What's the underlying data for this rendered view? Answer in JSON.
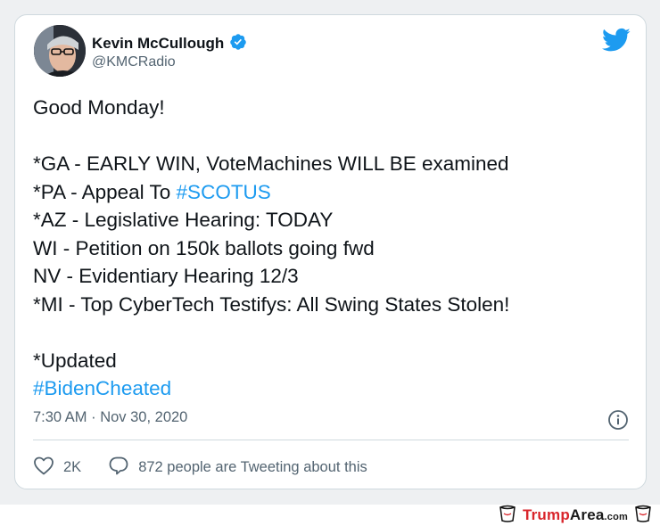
{
  "tweet": {
    "author": {
      "name": "Kevin McCullough",
      "handle": "@KMCRadio",
      "verified": true
    },
    "lines": [
      {
        "text": "Good Monday!"
      },
      {
        "text": ""
      },
      {
        "text": "*GA - EARLY WIN, VoteMachines WILL BE examined"
      },
      {
        "prefix": "*PA - Appeal To ",
        "hashtag": "#SCOTUS"
      },
      {
        "text": "*AZ - Legislative Hearing: TODAY"
      },
      {
        "text": "WI - Petition on 150k ballots going fwd"
      },
      {
        "text": "NV - Evidentiary Hearing 12/3"
      },
      {
        "text": "*MI - Top CyberTech Testifys: All Swing States Stolen!"
      },
      {
        "text": ""
      },
      {
        "text": "*Updated"
      },
      {
        "hashtag": "#BidenCheated"
      }
    ],
    "timestamp": "7:30 AM · Nov 30, 2020",
    "likes": "2K",
    "replies_text": "872 people are Tweeting about this"
  },
  "icons": {
    "logo": "twitter-bird-icon",
    "verified": "verified-badge-icon",
    "info": "info-icon",
    "like": "heart-icon",
    "reply": "comment-bubble-icon",
    "cup_left": "cup-icon",
    "cup_right": "cup-icon"
  },
  "colors": {
    "link": "#1d9bf0",
    "secondary_text": "#536471",
    "brand_red": "#d9262c"
  },
  "watermark": {
    "part1": "Trump",
    "part2": "Area",
    "part3": ".com"
  }
}
